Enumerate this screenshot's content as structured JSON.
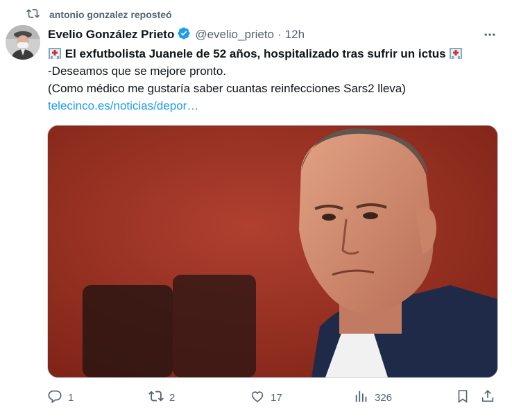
{
  "repost": {
    "text": "antonio gonzalez reposteó",
    "icon": "repost-icon"
  },
  "tweet": {
    "author_name": "Evelio González Prieto",
    "handle": "@evelio_prieto",
    "separator": "·",
    "time": "12h",
    "verified_icon": "verified-badge-icon",
    "line1": "El exfutbolista Juanele de 52 años, hospitalizado tras sufrir un ictus",
    "line2": "-Deseamos que se mejore pronto.",
    "line3": "(Como médico me gustaría saber cuantas reinfecciones Sars2 lleva)",
    "link": "telecinco.es/noticias/depor…",
    "emoji_icon": "hospital-icon"
  },
  "actions": {
    "replies": "1",
    "reposts": "2",
    "likes": "17",
    "views": "326"
  },
  "colors": {
    "accent": "#1d9bf0",
    "muted": "#536471",
    "text": "#0f1419"
  }
}
